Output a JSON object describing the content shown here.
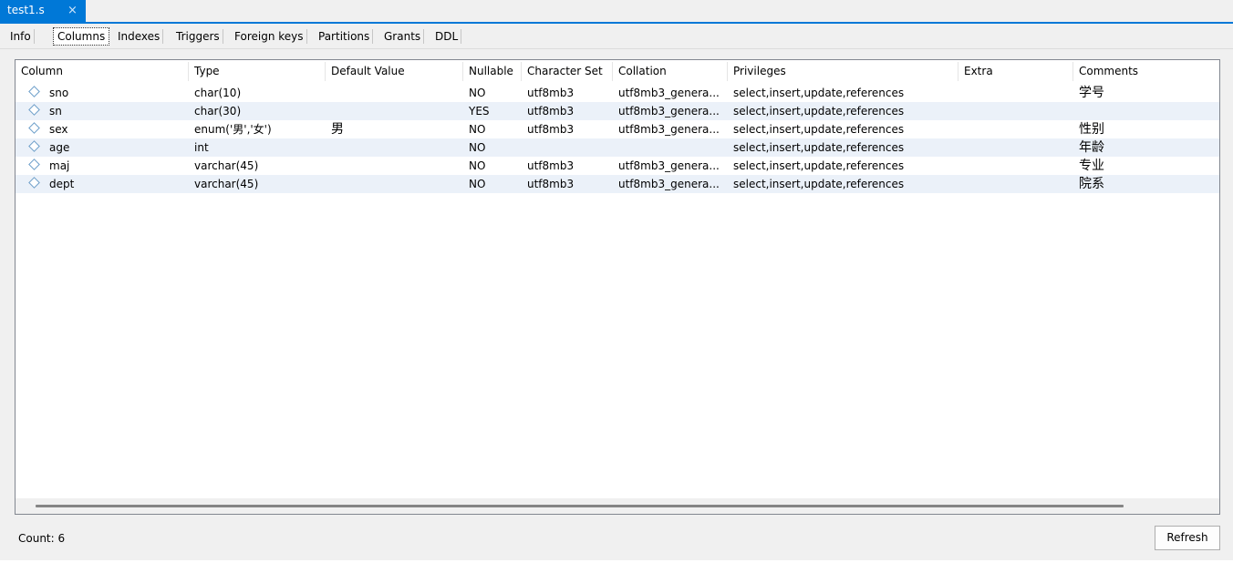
{
  "document_tab": {
    "title": "test1.s",
    "close_glyph": "×"
  },
  "subtabs": [
    "Info",
    "Columns",
    "Indexes",
    "Triggers",
    "Foreign keys",
    "Partitions",
    "Grants",
    "DDL"
  ],
  "active_subtab": "Columns",
  "table": {
    "headers": [
      "Column",
      "Type",
      "Default Value",
      "Nullable",
      "Character Set",
      "Collation",
      "Privileges",
      "Extra",
      "Comments"
    ],
    "rows": [
      {
        "column": "sno",
        "type": "char(10)",
        "default": "",
        "nullable": "NO",
        "charset": "utf8mb3",
        "collation": "utf8mb3_genera...",
        "privileges": "select,insert,update,references",
        "extra": "",
        "comments": "学号"
      },
      {
        "column": "sn",
        "type": "char(30)",
        "default": "",
        "nullable": "YES",
        "charset": "utf8mb3",
        "collation": "utf8mb3_genera...",
        "privileges": "select,insert,update,references",
        "extra": "",
        "comments": ""
      },
      {
        "column": "sex",
        "type": "enum('男','女')",
        "default": "男",
        "nullable": "NO",
        "charset": "utf8mb3",
        "collation": "utf8mb3_genera...",
        "privileges": "select,insert,update,references",
        "extra": "",
        "comments": "性别"
      },
      {
        "column": "age",
        "type": "int",
        "default": "",
        "nullable": "NO",
        "charset": "",
        "collation": "",
        "privileges": "select,insert,update,references",
        "extra": "",
        "comments": "年龄"
      },
      {
        "column": "maj",
        "type": "varchar(45)",
        "default": "",
        "nullable": "NO",
        "charset": "utf8mb3",
        "collation": "utf8mb3_genera...",
        "privileges": "select,insert,update,references",
        "extra": "",
        "comments": "专业"
      },
      {
        "column": "dept",
        "type": "varchar(45)",
        "default": "",
        "nullable": "NO",
        "charset": "utf8mb3",
        "collation": "utf8mb3_genera...",
        "privileges": "select,insert,update,references",
        "extra": "",
        "comments": "院系"
      }
    ]
  },
  "footer": {
    "count_label": "Count: 6",
    "refresh_label": "Refresh"
  },
  "colors": {
    "accent": "#0078d7",
    "row_alt": "#ebf1f9",
    "column_icon": "#6b9dc9"
  }
}
